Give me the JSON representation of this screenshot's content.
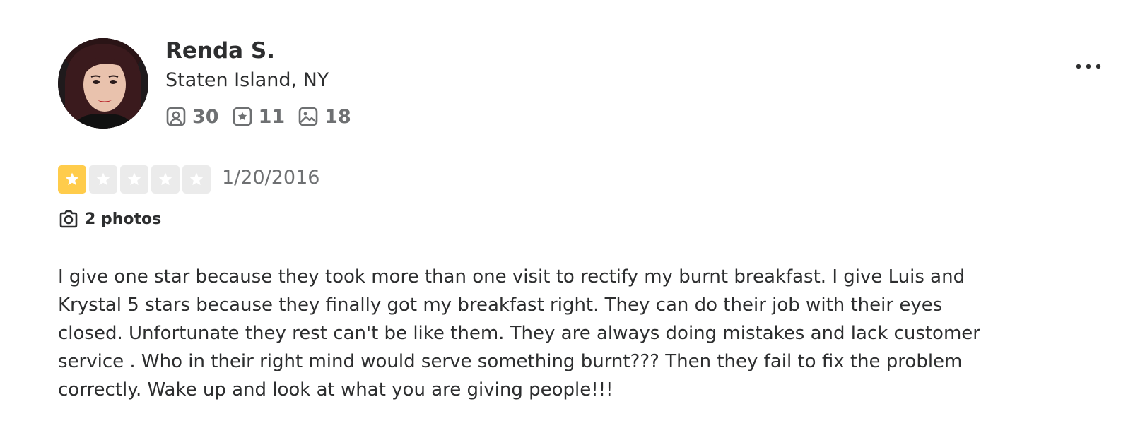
{
  "user": {
    "name": "Renda S.",
    "location": "Staten Island, NY",
    "stats": {
      "friends": "30",
      "reviews": "11",
      "photos": "18"
    }
  },
  "review": {
    "rating": 1,
    "rating_max": 5,
    "date": "1/20/2016",
    "photos_label": "2 photos",
    "text": "I give one star because they took more than one visit to rectify my burnt breakfast. I give Luis and Krystal 5 stars because they finally got my breakfast right. They can do their job with their eyes closed. Unfortunate they rest can't be like them. They are always doing mistakes and lack customer service . Who in their right mind would serve something burnt??? Then they fail to fix the problem correctly. Wake up and look at what you are giving people!!!"
  },
  "icons": {
    "friends": "friends-icon",
    "reviews": "review-star-icon",
    "photos": "photo-icon",
    "camera": "camera-icon",
    "more": "more-options-icon"
  },
  "colors": {
    "star_filled": "#ffcc4b",
    "star_empty": "#ebebeb",
    "text_primary": "#2d2e2f",
    "text_secondary": "#6e7072"
  }
}
